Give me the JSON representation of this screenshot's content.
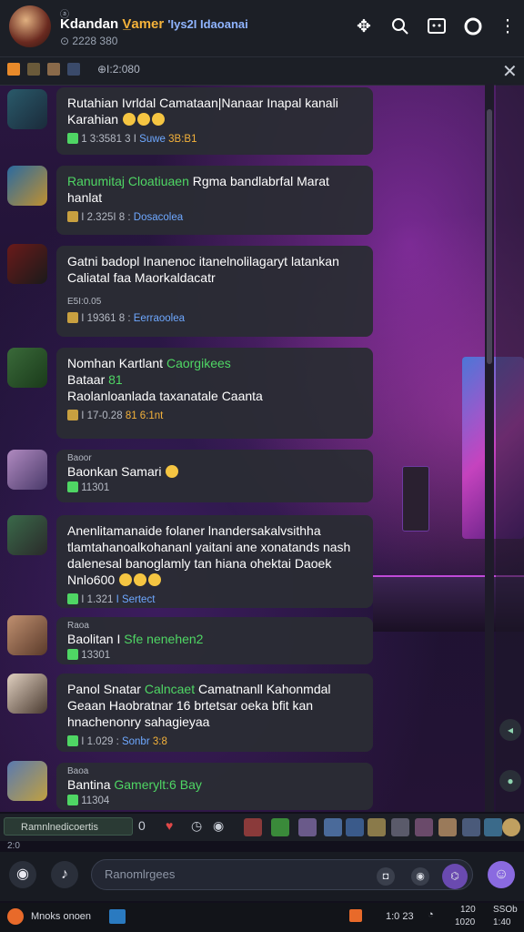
{
  "header": {
    "badge": "ⓐ",
    "title_part1": "Kdandan",
    "title_part2": "V̲amer",
    "title_part3": "'Iys2I Idaoanai",
    "subtitle": "⊙ 2228 380",
    "icons": [
      "puzzle-icon",
      "search-icon",
      "chat-icon",
      "record-icon",
      "more-vertical-icon"
    ]
  },
  "pinned": {
    "text": "⊕I:2:080",
    "close": "✕"
  },
  "messages": [
    {
      "avatar": "hero-avatar-1",
      "text": "Rutahian Ivrldal Camataan|Nanaar Inapal kanali Karahian",
      "meta_num": "1 3:3581 3 I",
      "meta_link": "Suwe",
      "meta_extra": "3B:B1"
    },
    {
      "avatar": "hero-avatar-2",
      "name": "Ranumitaj Cloatiuaen",
      "text": "Rgma bandlabrfal Marat hanlat",
      "meta_num": "I 2.325I 8 :",
      "meta_link": "Dosacolea"
    },
    {
      "avatar": "hero-avatar-3",
      "text": "Gatni badopl Inanenoc itanelnolilagaryt latankan Caliatal faa Maorkaldacatr",
      "small": "E5I:0.05",
      "meta_num": "I 19361 8 :",
      "meta_link": "Eerraoolea"
    },
    {
      "avatar": "hero-avatar-4",
      "name_line": "Nomhan Kartlant",
      "name_green": "Caorgikees",
      "text2": "Bataar",
      "text2_green": "81",
      "text3": "Raolanloanlada taxanatale Caanta",
      "meta_num": "I 17-0.28",
      "meta_extra": "81 6:1nt"
    },
    {
      "avatar": "hero-avatar-5",
      "small": "Baoor",
      "text": "Baonkan Samari",
      "meta_num": "11301"
    },
    {
      "avatar": "hero-avatar-6",
      "text": "Anenlitamanaide folaner lnandersakalvsithha tlamtahanoalkohananl yaitani ane xonatands nash dalenesal banoglamly tan hiana ohektai Daoek Nnlo600",
      "meta_num": "I 1.321",
      "meta_link": "I Sertect"
    },
    {
      "avatar": "hero-avatar-7",
      "small": "Raoa",
      "text": "Baolitan I",
      "text_green": "Sfe nenehen2",
      "meta_num": "13301"
    },
    {
      "avatar": "hero-avatar-8",
      "name": "Panol Snatar",
      "name_green": "Calncaet",
      "text": "Camatnanll Kahonmdal Geaan Haobratnar 16 brtetsar oeka bfit kan hnachenonry sahagieyaa",
      "meta_num": "I 1.029 :",
      "meta_link": "Sonbr",
      "meta_extra": "3:8"
    },
    {
      "avatar": "hero-avatar-9",
      "small": "Baoa",
      "text": "Bantina",
      "text_green": "Gamerylt:6 Bay",
      "meta_num": "11304"
    }
  ],
  "strip": {
    "input": "Ramnlnedicoertis",
    "o_label": "0"
  },
  "counter": "2:0",
  "composer": {
    "placeholder": "Ranomlrgees"
  },
  "status": {
    "app": "Mnoks onoen",
    "right1": "1:0 23",
    "right2": "120",
    "right3": "SSOb",
    "right4": "1020",
    "right5": "1:40"
  },
  "colors": {
    "accent_green": "#4fd664",
    "link_blue": "#6ea8ff",
    "title_gold": "#f4b23a",
    "bubble_bg": "#2a2c34",
    "header_bg": "#1c1f26"
  }
}
